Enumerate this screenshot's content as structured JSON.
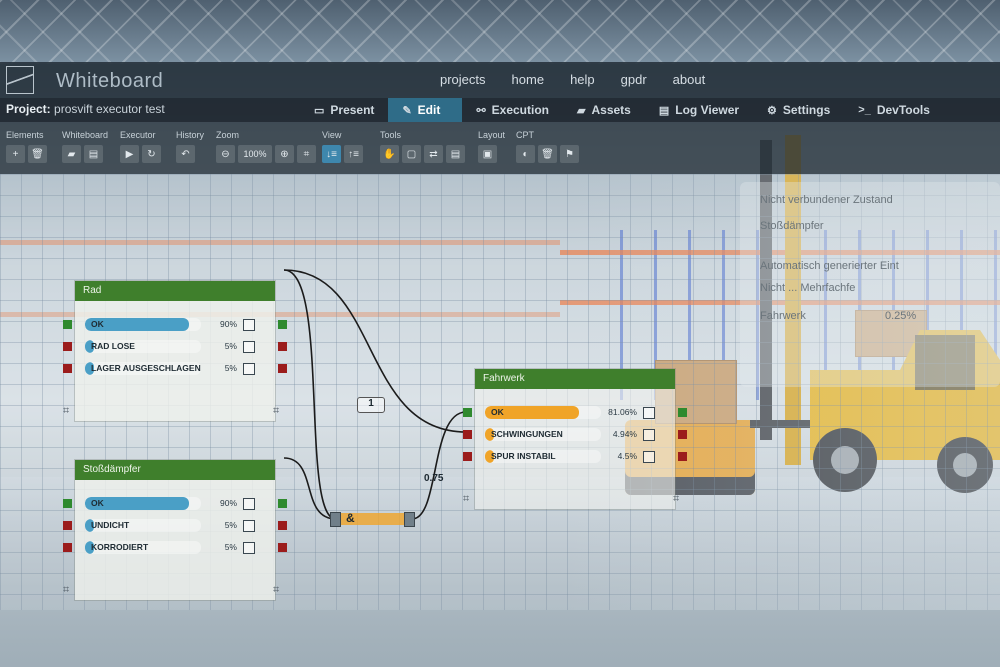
{
  "app": {
    "brand": "Whiteboard"
  },
  "topnav": [
    "projects",
    "home",
    "help",
    "gpdr",
    "about"
  ],
  "project": {
    "label": "Project:",
    "name": "prosvift executor test"
  },
  "tabs": [
    {
      "label": "Present",
      "icon": "monitor-icon"
    },
    {
      "label": "Edit",
      "icon": "edit-icon",
      "active": true
    },
    {
      "label": "Execution",
      "icon": "nodes-icon"
    },
    {
      "label": "Assets",
      "icon": "folder-icon"
    },
    {
      "label": "Log Viewer",
      "icon": "document-icon"
    },
    {
      "label": "Settings",
      "icon": "gear-icon"
    },
    {
      "label": "DevTools",
      "icon": "terminal-icon"
    }
  ],
  "toolbar": {
    "groups": [
      "Elements",
      "Whiteboard",
      "Executor",
      "History",
      "Zoom",
      "View",
      "Tools",
      "Layout",
      "CPT"
    ],
    "zoom_value": "100%"
  },
  "nodes": {
    "rad": {
      "title": "Rad",
      "rows": [
        {
          "label": "OK",
          "pct": "90%",
          "value": 0.9
        },
        {
          "label": "RAD LOSE",
          "pct": "5%",
          "value": 0.05
        },
        {
          "label": "LAGER AUSGESCHLAGEN",
          "pct": "5%",
          "value": 0.05
        }
      ]
    },
    "stossdaempfer": {
      "title": "Stoßdämpfer",
      "rows": [
        {
          "label": "OK",
          "pct": "90%",
          "value": 0.9
        },
        {
          "label": "UNDICHT",
          "pct": "5%",
          "value": 0.05
        },
        {
          "label": "KORRODIERT",
          "pct": "5%",
          "value": 0.05
        }
      ]
    },
    "fahrwerk": {
      "title": "Fahrwerk",
      "rows": [
        {
          "label": "OK",
          "pct": "81.06%",
          "value": 0.8106
        },
        {
          "label": "SCHWINGUNGEN",
          "pct": "4.94%",
          "value": 0.0494
        },
        {
          "label": "SPUR INSTABIL",
          "pct": "4.5%",
          "value": 0.045
        }
      ]
    }
  },
  "edges": {
    "weight_1": "1",
    "weight_2": "0.75",
    "operator": "&"
  },
  "ghost_panel": {
    "line1": "Nicht verbundener Zustand",
    "line2": "Stoßdämpfer",
    "line3": "Automatisch generierter Eint",
    "line4": "Nicht ... Mehrfachfe",
    "line5": "0.25%",
    "line6": "Fahrwerk"
  },
  "colors": {
    "header_green": "#3f7f2c",
    "bar_blue": "#4a9fc6",
    "bar_orange": "#f0a428",
    "accent_tab": "#2f6c88"
  }
}
